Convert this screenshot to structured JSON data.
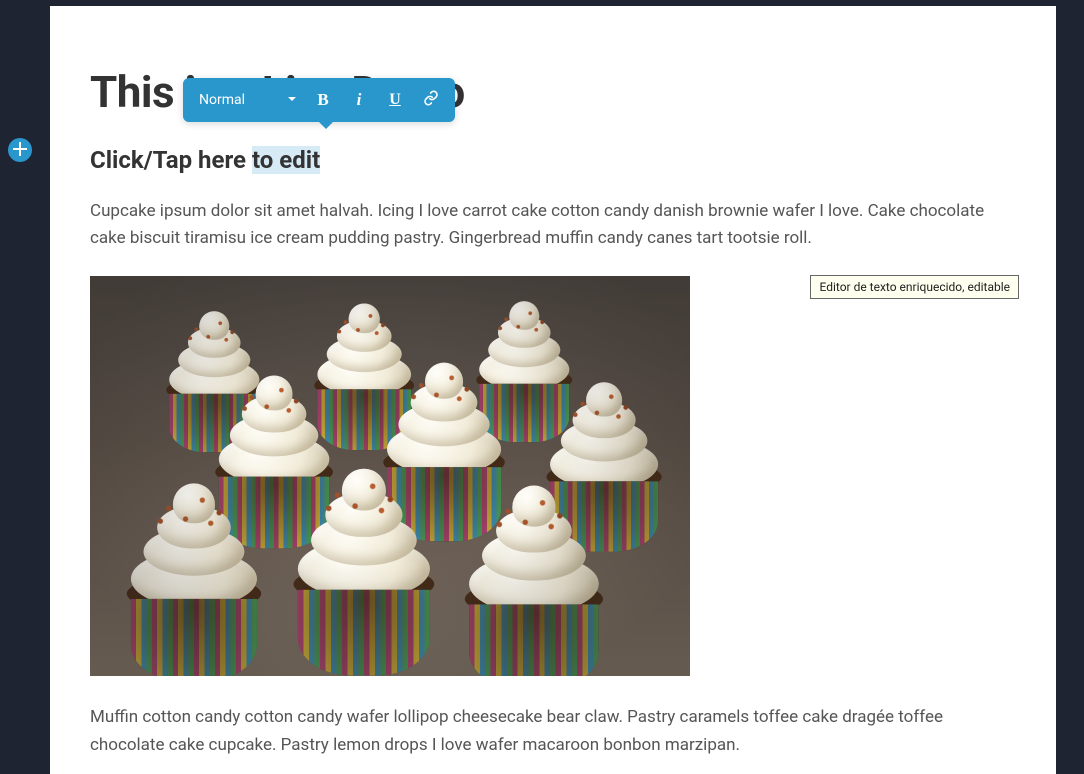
{
  "title": "This is a Live Demo",
  "subtitle_before": "Click/Tap here ",
  "subtitle_highlight": "to edit",
  "paragraph1": "Cupcake ipsum dolor sit amet halvah. Icing I love carrot cake cotton candy danish brownie wafer I love. Cake chocolate cake biscuit tiramisu ice cream pudding pastry. Gingerbread muffin candy canes tart tootsie roll.",
  "paragraph2": "Muffin cotton candy cotton candy wafer lollipop cheesecake bear claw. Pastry caramels toffee cake dragée toffee chocolate cake cupcake. Pastry lemon drops I love wafer macaroon bonbon marzipan.",
  "toolbar": {
    "format_label": "Normal",
    "colors": {
      "bg": "#2996cc"
    }
  },
  "tooltip": "Editor de texto enriquecido, editable"
}
